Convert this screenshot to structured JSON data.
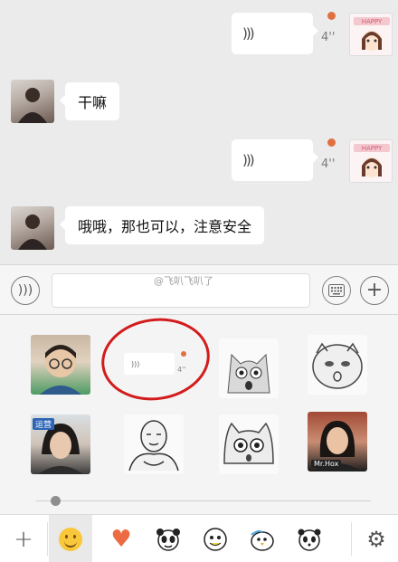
{
  "chat": {
    "messages": [
      {
        "type": "voice",
        "side": "right",
        "duration": "4''"
      },
      {
        "type": "text",
        "side": "left",
        "text": "干嘛"
      },
      {
        "type": "voice",
        "side": "right",
        "duration": "4''"
      },
      {
        "type": "text",
        "side": "left",
        "text": "哦哦，那也可以，注意安全"
      }
    ],
    "self_avatar_text": "HAPPY"
  },
  "input_bar": {
    "voice_toggle_icon": "voice-icon",
    "keyboard_icon": "keyboard-icon",
    "add_icon": "plus-icon",
    "watermark": "@飞叭飞叭了"
  },
  "stickers": {
    "mini_voice_duration": "4''",
    "caption_mrhox": "Mr.Hox",
    "caption_badge": "运营"
  },
  "tab_bar": {
    "add_icon": "+",
    "heart": "♥",
    "settings_icon": "⚙"
  },
  "colors": {
    "accent_dot": "#e0703f",
    "highlight_circle": "#d21c1c",
    "heart": "#ec6b43"
  }
}
